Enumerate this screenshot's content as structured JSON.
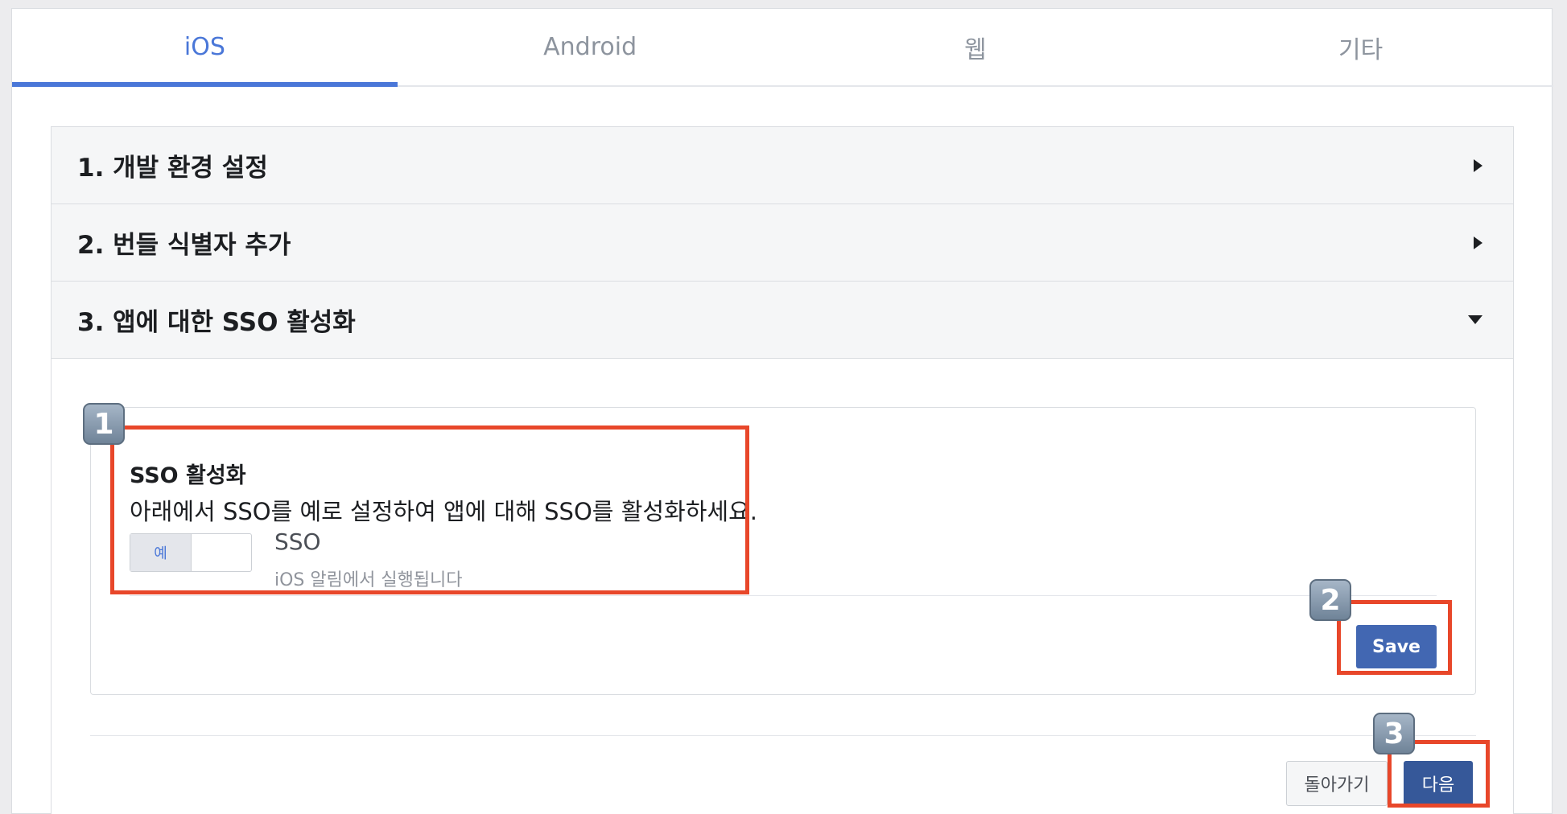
{
  "tabs": [
    "iOS",
    "Android",
    "웹",
    "기타"
  ],
  "accordion": {
    "step1": "1. 개발 환경 설정",
    "step2": "2. 번들 식별자 추가",
    "step3": "3. 앱에 대한 SSO 활성화"
  },
  "sso": {
    "title": "SSO 활성화",
    "description": "아래에서 SSO를 예로 설정하여 앱에 대해 SSO를 활성화하세요.",
    "toggle_on_label": "예",
    "option_label": "SSO",
    "option_subtext": "iOS 알림에서 실행됩니다",
    "save_label": "Save"
  },
  "footer": {
    "back_label": "돌아가기",
    "next_label": "다음"
  },
  "badges": [
    "1",
    "2",
    "3"
  ],
  "colors": {
    "accent": "#4a77d8",
    "primary_button": "#4267b2",
    "highlight": "#e8472a"
  }
}
